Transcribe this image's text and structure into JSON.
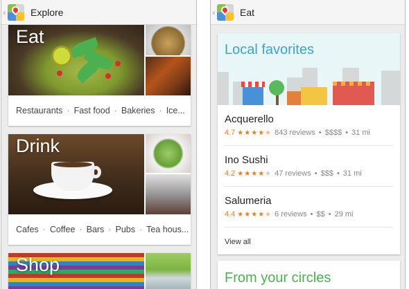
{
  "left": {
    "title": "Explore",
    "cards": [
      {
        "heading": "Eat",
        "links": [
          "Restaurants",
          "Fast food",
          "Bakeries",
          "Ice..."
        ]
      },
      {
        "heading": "Drink",
        "links": [
          "Cafes",
          "Coffee",
          "Bars",
          "Pubs",
          "Tea hous..."
        ]
      },
      {
        "heading": "Shop"
      }
    ],
    "separator": "·"
  },
  "right": {
    "title": "Eat",
    "local_title": "Local favorites",
    "places": [
      {
        "name": "Acquerello",
        "rating": "4.7",
        "stars": 4.5,
        "reviews": "843 reviews",
        "price": "$$$$",
        "distance": "31 mi"
      },
      {
        "name": "Ino Sushi",
        "rating": "4.2",
        "stars": 4,
        "reviews": "47 reviews",
        "price": "$$$",
        "distance": "31 mi"
      },
      {
        "name": "Salumeria",
        "rating": "4.4",
        "stars": 4.5,
        "reviews": "6 reviews",
        "price": "$$",
        "distance": "29 mi"
      }
    ],
    "view_all": "View all",
    "circles_title": "From your circles",
    "dot": "•"
  },
  "colors": {
    "teal": "#3ba5c4",
    "green": "#4caf50",
    "orange": "#e67e22"
  },
  "icons": {
    "app": "google-maps-icon",
    "back": "up-caret-icon",
    "star": "star-icon"
  }
}
